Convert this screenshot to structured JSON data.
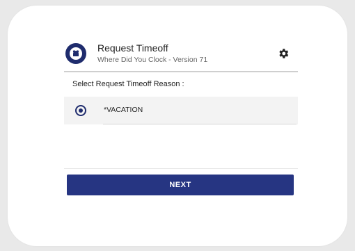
{
  "header": {
    "title": "Request Timeoff",
    "subtitle": "Where Did You Clock - Version 71",
    "logo_icon": "clock-logo-icon",
    "settings_icon": "gear-icon"
  },
  "prompt": "Select Request Timeoff Reason :",
  "options": [
    {
      "label": "*VACATION",
      "selected": true
    }
  ],
  "next_button": {
    "label": "NEXT"
  },
  "colors": {
    "primary": "#263582",
    "logo": "#1f2c6d",
    "row_background": "#f3f3f3",
    "page_background": "#e9e9e9"
  }
}
